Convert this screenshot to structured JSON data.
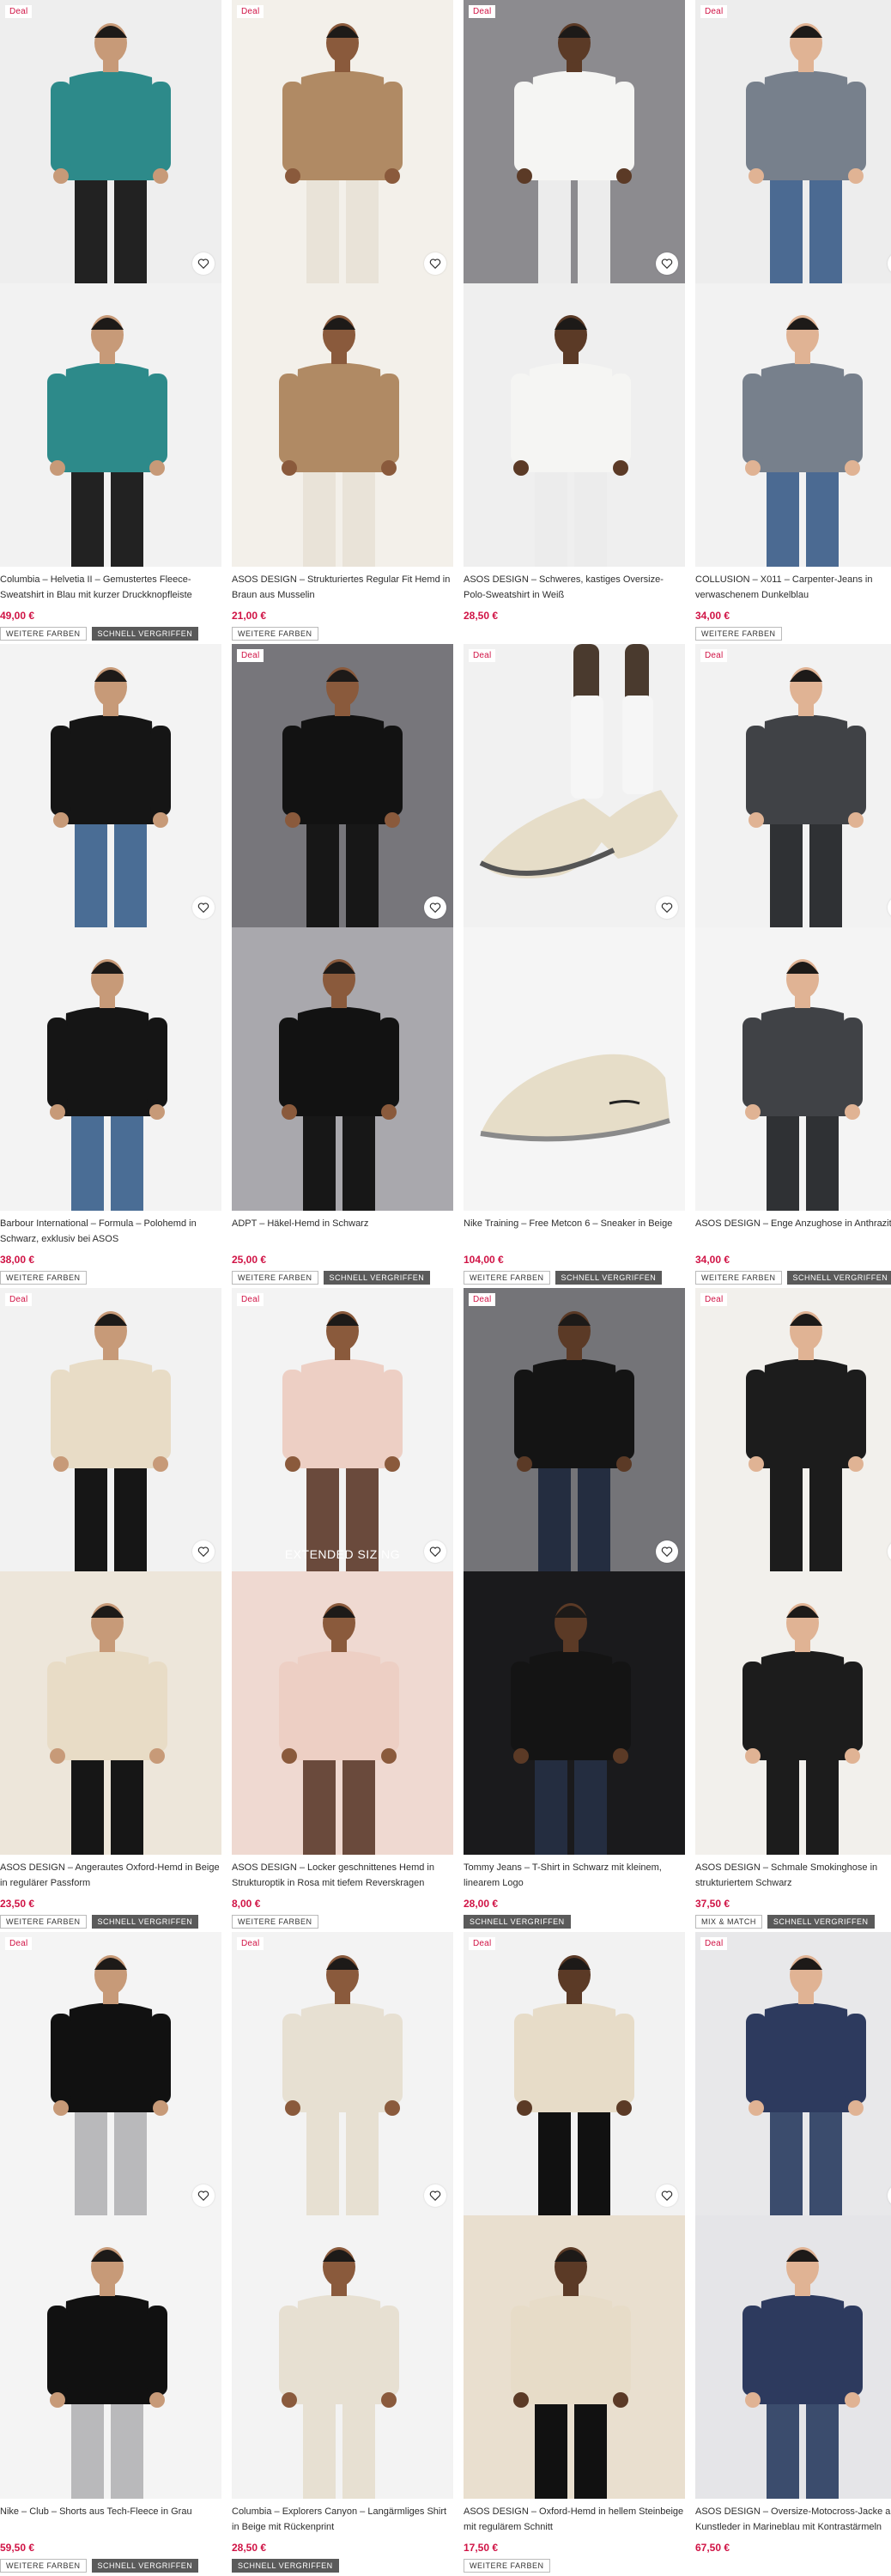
{
  "colors": {
    "price": "#d01345",
    "deal": "#d01345",
    "tag_dark": "#5a5a5a"
  },
  "products": [
    {
      "deal": "Deal",
      "description": "Columbia – Helvetia II – Gemustertes Fleece-Sweatshirt in Blau mit kurzer Druckknopfleiste",
      "price": "49,00 €",
      "tags": [
        "WEITERE FARBEN",
        "SCHNELL VERGRIFFEN"
      ],
      "overlay_text": "",
      "bg1": "#eeeeee",
      "bg2": "#f2f2f2",
      "shirt": "#2d8a8a",
      "pants": "#222222"
    },
    {
      "deal": "Deal",
      "description": "ASOS DESIGN – Strukturiertes Regular Fit Hemd in Braun aus Musselin",
      "price": "21,00 €",
      "tags": [
        "WEITERE FARBEN"
      ],
      "overlay_text": "",
      "bg1": "#f3f0ea",
      "bg2": "#f3f0ea",
      "shirt": "#b08a64",
      "pants": "#e9e3d8"
    },
    {
      "deal": "Deal",
      "description": "ASOS DESIGN – Schweres, kastiges Oversize-Polo-Sweatshirt in Weiß",
      "price": "28,50 €",
      "tags": [],
      "overlay_text": "",
      "bg1": "#8c8b8f",
      "bg2": "#efefef",
      "shirt": "#f5f5f3",
      "pants": "#ececec"
    },
    {
      "deal": "Deal",
      "description": "COLLUSION – X011 – Carpenter-Jeans in verwaschenem Dunkelblau",
      "price": "34,00 €",
      "tags": [
        "WEITERE FARBEN"
      ],
      "overlay_text": "",
      "bg1": "#ededed",
      "bg2": "#f2f2f2",
      "shirt": "#77808c",
      "pants": "#4b6a92"
    },
    {
      "deal": "",
      "description": "Barbour International – Formula – Polohemd in Schwarz, exklusiv bei ASOS",
      "price": "38,00 €",
      "tags": [
        "WEITERE FARBEN"
      ],
      "overlay_text": "",
      "bg1": "#f3f3f3",
      "bg2": "#f3f3f3",
      "shirt": "#151515",
      "pants": "#4a6d95"
    },
    {
      "deal": "Deal",
      "description": "ADPT – Häkel-Hemd in Schwarz",
      "price": "25,00 €",
      "tags": [
        "WEITERE FARBEN",
        "SCHNELL VERGRIFFEN"
      ],
      "overlay_text": "",
      "bg1": "#77767b",
      "bg2": "#a9a8ad",
      "shirt": "#121212",
      "pants": "#171717"
    },
    {
      "deal": "Deal",
      "description": "Nike Training – Free Metcon 6 – Sneaker in Beige",
      "price": "104,00 €",
      "tags": [
        "WEITERE FARBEN",
        "SCHNELL VERGRIFFEN"
      ],
      "overlay_text": "",
      "bg1": "#f1f1f1",
      "bg2": "#f5f5f5",
      "shirt": "#e6ddc8",
      "pants": "#e6ddc8"
    },
    {
      "deal": "Deal",
      "description": "ASOS DESIGN – Enge Anzughose in Anthrazit",
      "price": "34,00 €",
      "tags": [
        "WEITERE FARBEN",
        "SCHNELL VERGRIFFEN"
      ],
      "overlay_text": "",
      "bg1": "#f2f2f2",
      "bg2": "#f4f4f4",
      "shirt": "#404246",
      "pants": "#2f3134"
    },
    {
      "deal": "Deal",
      "description": "ASOS DESIGN – Angerautes Oxford-Hemd in Beige in regulärer Passform",
      "price": "23,50 €",
      "tags": [
        "WEITERE FARBEN",
        "SCHNELL VERGRIFFEN"
      ],
      "overlay_text": "",
      "bg1": "#f2f2f2",
      "bg2": "#ede6da",
      "shirt": "#e8dcc6",
      "pants": "#161616"
    },
    {
      "deal": "Deal",
      "description": "ASOS DESIGN – Locker geschnittenes Hemd in Strukturoptik in Rosa mit tiefem Reverskragen",
      "price": "8,00 €",
      "tags": [
        "WEITERE FARBEN"
      ],
      "overlay_text": "EXTENDED SIZING",
      "bg1": "#f3f3f3",
      "bg2": "#efd9d1",
      "shirt": "#edcfc4",
      "pants": "#6a4a3c"
    },
    {
      "deal": "Deal",
      "description": "Tommy Jeans – T-Shirt in Schwarz mit kleinem, linearem Logo",
      "price": "28,00 €",
      "tags": [
        "SCHNELL VERGRIFFEN"
      ],
      "overlay_text": "",
      "bg1": "#747478",
      "bg2": "#1a1a1c",
      "shirt": "#141414",
      "pants": "#242d40"
    },
    {
      "deal": "Deal",
      "description": "ASOS DESIGN – Schmale Smokinghose in strukturiertem Schwarz",
      "price": "37,50 €",
      "tags": [
        "MIX & MATCH",
        "SCHNELL VERGRIFFEN"
      ],
      "overlay_text": "",
      "bg1": "#f2f0ec",
      "bg2": "#f2f0ec",
      "shirt": "#1c1c1c",
      "pants": "#1c1c1c"
    },
    {
      "deal": "Deal",
      "description": "Nike – Club – Shorts aus Tech-Fleece in Grau",
      "price": "59,50 €",
      "tags": [
        "WEITERE FARBEN",
        "SCHNELL VERGRIFFEN"
      ],
      "overlay_text": "",
      "bg1": "#f4f4f4",
      "bg2": "#f4f4f4",
      "shirt": "#111111",
      "pants": "#b9b9bb"
    },
    {
      "deal": "Deal",
      "description": "Columbia – Explorers Canyon – Langärmliges Shirt in Beige mit Rückenprint",
      "price": "28,50 €",
      "tags": [
        "SCHNELL VERGRIFFEN"
      ],
      "overlay_text": "",
      "bg1": "#f3f3f3",
      "bg2": "#f3f3f3",
      "shirt": "#e7e0d2",
      "pants": "#e7e0d2"
    },
    {
      "deal": "Deal",
      "description": "ASOS DESIGN – Oxford-Hemd in hellem Steinbeige mit regulärem Schnitt",
      "price": "17,50 €",
      "tags": [
        "WEITERE FARBEN"
      ],
      "overlay_text": "",
      "bg1": "#f2f2f2",
      "bg2": "#e9dfcf",
      "shirt": "#e7dcc8",
      "pants": "#111111"
    },
    {
      "deal": "Deal",
      "description": "ASOS DESIGN – Oversize-Motocross-Jacke aus Kunstleder in Marineblau mit Kontrastärmeln",
      "price": "67,50 €",
      "tags": [],
      "overlay_text": "",
      "bg1": "#e8e8ea",
      "bg2": "#e5e5e8",
      "shirt": "#2d3a5e",
      "pants": "#3b4c6d"
    }
  ]
}
